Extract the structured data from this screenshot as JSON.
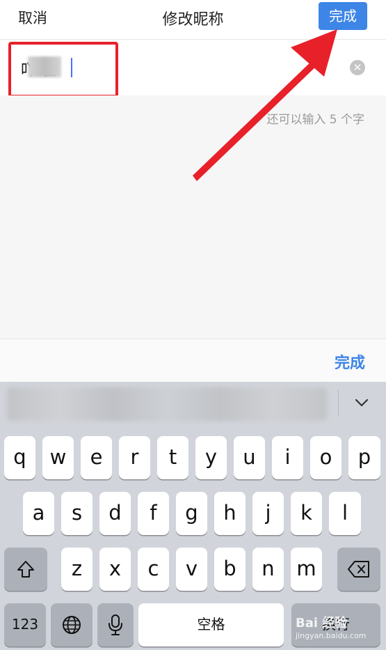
{
  "nav": {
    "cancel_label": "取消",
    "title": "修改昵称",
    "done_label": "完成"
  },
  "input": {
    "value": "吖 留"
  },
  "hint": "还可以输入 5 个字",
  "accessory": {
    "done_label": "完成"
  },
  "keyboard": {
    "row1": [
      "q",
      "w",
      "e",
      "r",
      "t",
      "y",
      "u",
      "i",
      "o",
      "p"
    ],
    "row2": [
      "a",
      "s",
      "d",
      "f",
      "g",
      "h",
      "j",
      "k",
      "l"
    ],
    "row3": [
      "z",
      "x",
      "c",
      "v",
      "b",
      "n",
      "m"
    ],
    "numbers_label": "123",
    "space_label": "空格",
    "return_label": "换行"
  },
  "watermark": {
    "brand": "Bai 经验",
    "url": "jingyan.baidu.com"
  },
  "colors": {
    "accent": "#3d85e6",
    "highlight": "#e8202a"
  }
}
